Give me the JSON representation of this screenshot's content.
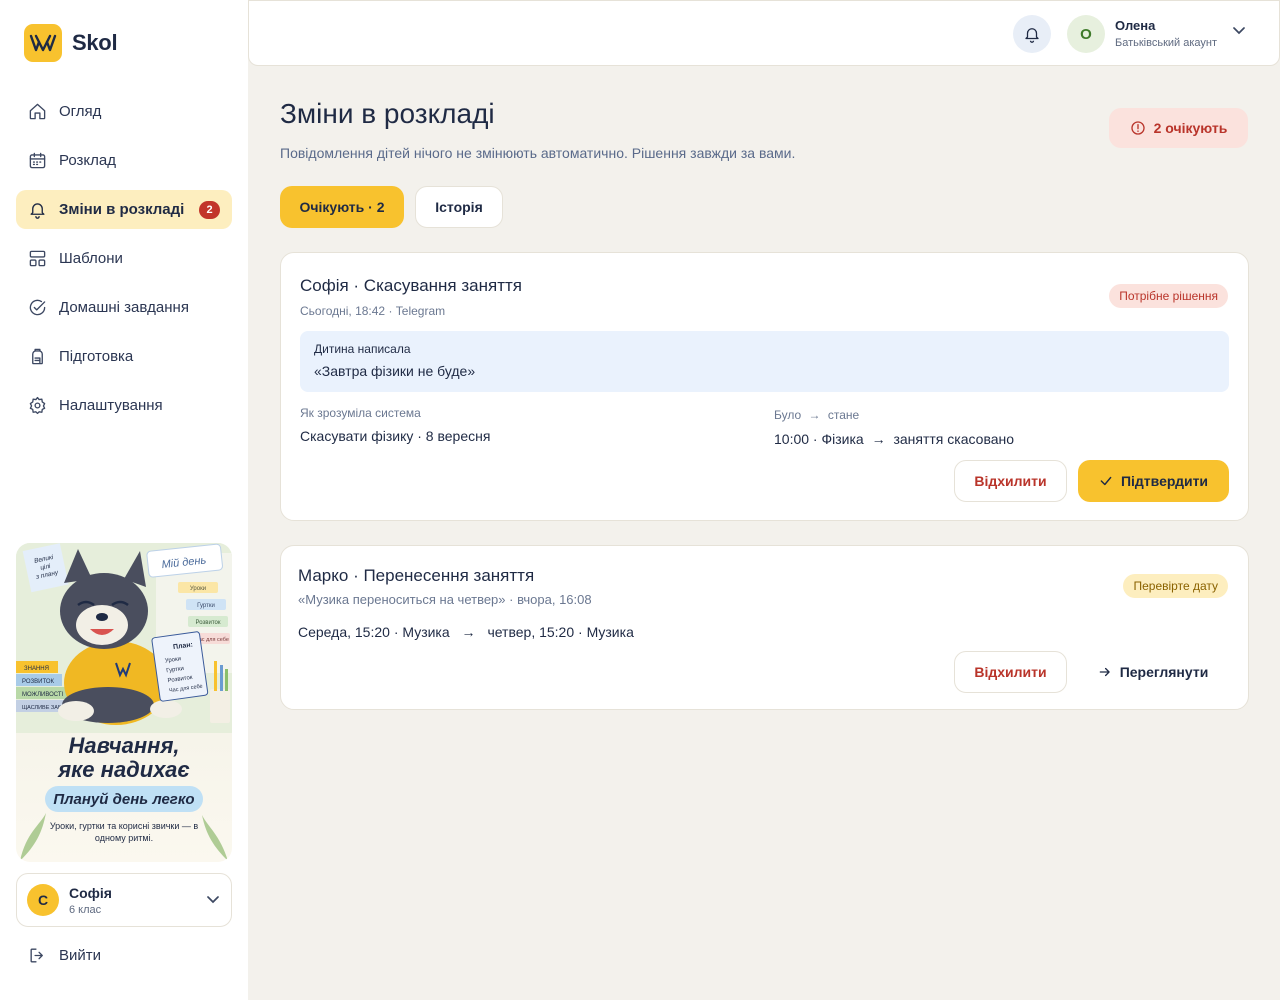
{
  "brand": {
    "name": "Skol",
    "accent": "#f8c22e"
  },
  "sidebar": {
    "items": [
      {
        "label": "Огляд",
        "icon": "home-icon"
      },
      {
        "label": "Розклад",
        "icon": "calendar-icon"
      },
      {
        "label": "Зміни в розкладі",
        "icon": "bell-icon",
        "badge": "2",
        "active": true
      },
      {
        "label": "Шаблони",
        "icon": "templates-icon"
      },
      {
        "label": "Домашні завдання",
        "icon": "check-circle-icon"
      },
      {
        "label": "Підготовка",
        "icon": "backpack-icon"
      },
      {
        "label": "Налаштування",
        "icon": "gear-icon"
      }
    ],
    "promo": {
      "title_line1": "Навчання,",
      "title_line2": "яке надихає",
      "pill": "Плануй день легко",
      "subtitle": "Уроки, гуртки та корисні звички — в одному ритмі.",
      "note_board": "Мій день",
      "board_items": [
        "Уроки",
        "Гуртки",
        "Розвиток",
        "Час для себе"
      ],
      "sticky_note": "Великі цілі починаються з плану",
      "notebook_title": "План:",
      "notebook_items": [
        "Уроки",
        "Гуртки",
        "Розвиток",
        "Час для себе"
      ],
      "books": [
        "ЗНАННЯ",
        "РОЗВИТОК",
        "МОЖЛИВОСТІ",
        "ЩАСЛИВЕ ЗАВТРА"
      ]
    },
    "child": {
      "initial": "С",
      "name": "Софія",
      "grade": "6 клас"
    },
    "logout_label": "Вийти"
  },
  "header": {
    "user": {
      "initial": "О",
      "name": "Олена",
      "role": "Батьківський акаунт"
    }
  },
  "main": {
    "title": "Зміни в розкладі",
    "subtitle": "Повідомлення дітей нічого не змінюють автоматично. Рішення завжди за вами.",
    "pending_pill": "2 очікують",
    "tabs": [
      {
        "label": "Очікують · 2",
        "active": true
      },
      {
        "label": "Історія",
        "active": false
      }
    ],
    "cards": [
      {
        "title": "Софія · Скасування заняття",
        "meta": "Сьогодні, 18:42 · Telegram",
        "status": "Потрібне рішення",
        "quote_label": "Дитина написала",
        "quote": "«Завтра фізики не буде»",
        "understood_label": "Як зрозуміла система",
        "understood_value": "Скасувати фізику · 8 вересня",
        "change_label_from": "Було",
        "change_label_to": "стане",
        "change_from": "10:00 · Фізика",
        "change_to": "заняття скасовано",
        "reject_label": "Відхилити",
        "confirm_label": "Підтвердити"
      },
      {
        "title": "Марко · Перенесення заняття",
        "meta": "«Музика переноситься на четвер» · вчора, 16:08",
        "status": "Перевірте дату",
        "change_from": "Середа, 15:20 · Музика",
        "change_to": "четвер, 15:20 · Музика",
        "reject_label": "Відхилити",
        "view_label": "Переглянути"
      }
    ]
  }
}
